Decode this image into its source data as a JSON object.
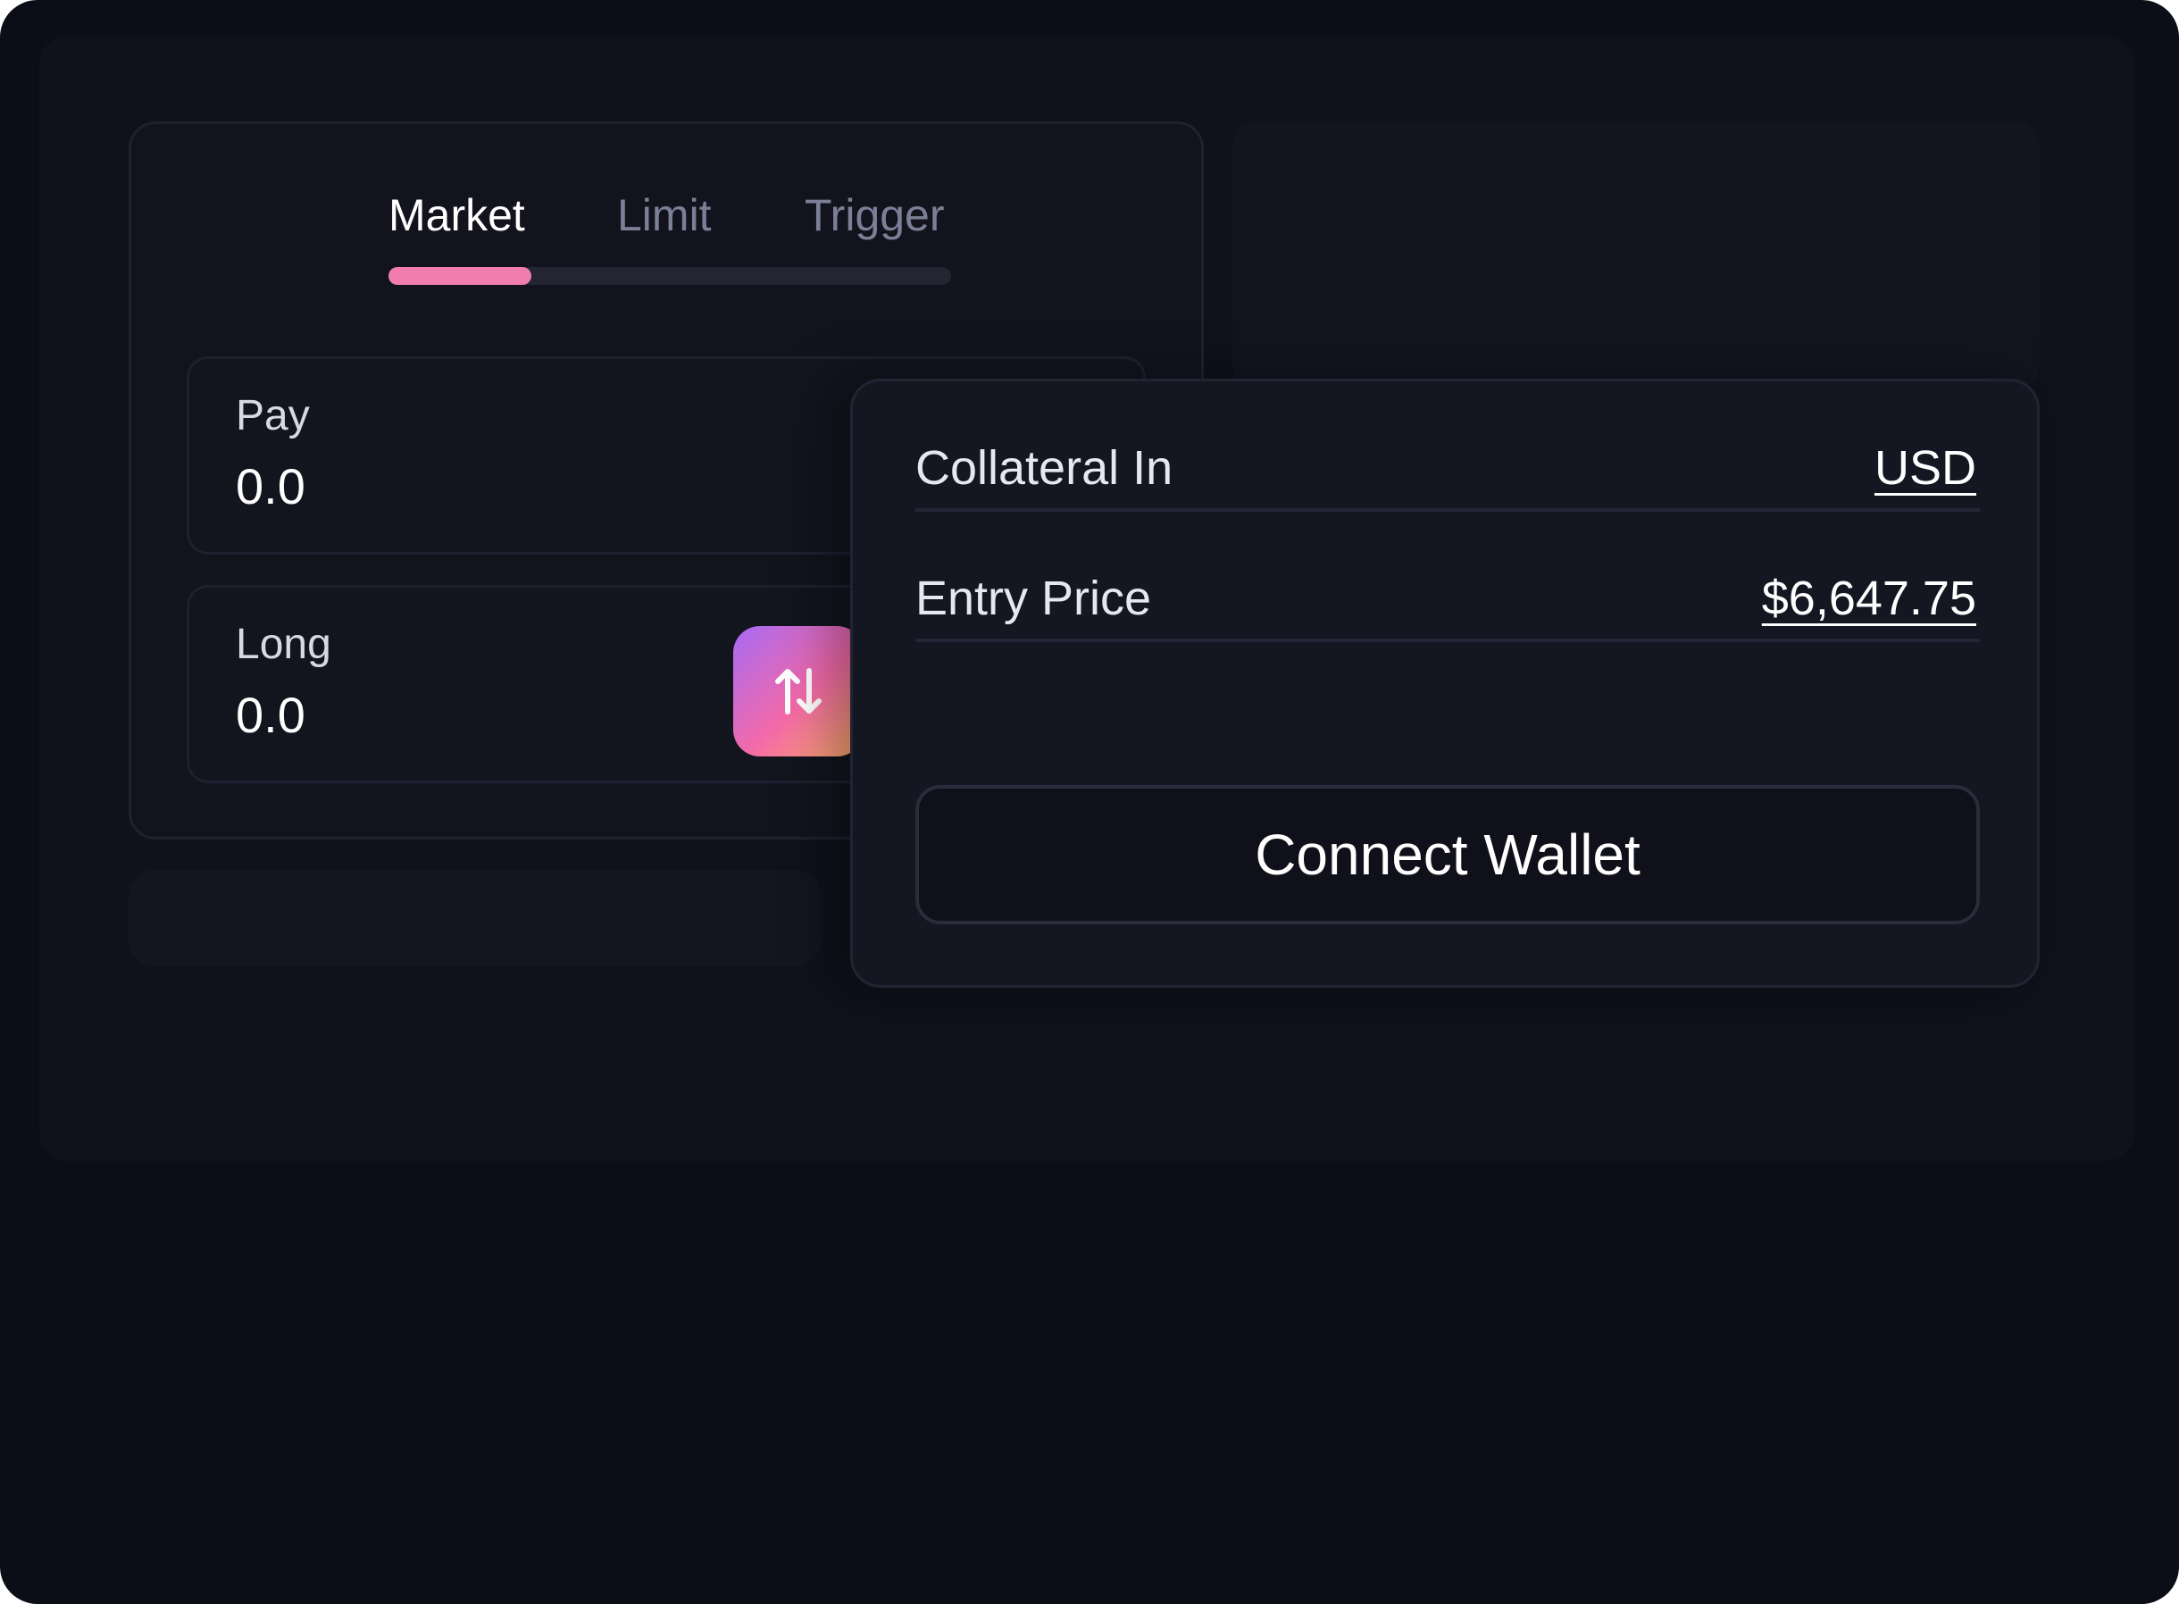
{
  "tabs": [
    {
      "label": "Market",
      "active": true
    },
    {
      "label": "Limit",
      "active": false
    },
    {
      "label": "Trigger",
      "active": false
    }
  ],
  "pay": {
    "label": "Pay",
    "value": "0.0"
  },
  "long": {
    "label": "Long",
    "value": "0.0"
  },
  "swap": {
    "icon": "swap-arrows-icon"
  },
  "details": {
    "collateral_label": "Collateral In",
    "collateral_value": "USD",
    "entry_price_label": "Entry Price",
    "entry_price_value": "$6,647.75"
  },
  "connect_wallet_label": "Connect Wallet",
  "colors": {
    "background": "#0b0d17",
    "accent": "#f07cb0",
    "swap_gradient": [
      "#a66af5",
      "#f46aa8",
      "#ffb067"
    ]
  }
}
